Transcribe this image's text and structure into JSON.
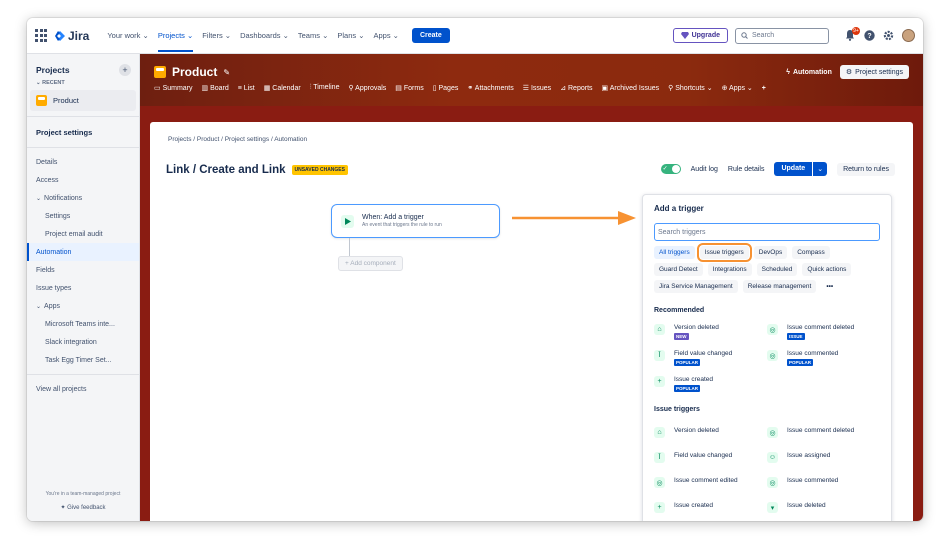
{
  "topnav": {
    "logo": "Jira",
    "items": [
      "Your work ⌄",
      "Projects ⌄",
      "Filters ⌄",
      "Dashboards ⌄",
      "Teams ⌄",
      "Plans ⌄",
      "Apps ⌄"
    ],
    "create": "Create",
    "upgrade": "Upgrade",
    "search_placeholder": "Search",
    "notif_count": "9+"
  },
  "sidebar": {
    "title": "Projects",
    "recent": "RECENT",
    "project": "Product",
    "settings": "Project settings",
    "items": [
      "Details",
      "Access",
      "Notifications",
      "Settings",
      "Project email audit",
      "Automation",
      "Fields",
      "Issue types",
      "Apps",
      "Microsoft Teams inte...",
      "Slack integration",
      "Task Egg Timer Set..."
    ],
    "view_all": "View all projects",
    "footer": "You're in a team-managed project",
    "feedback": "Give feedback"
  },
  "project": {
    "title": "Product",
    "automation": "Automation",
    "settings_btn": "Project settings",
    "tabs": [
      "Summary",
      "Board",
      "List",
      "Calendar",
      "Timeline",
      "Approvals",
      "Forms",
      "Pages",
      "Attachments",
      "Issues",
      "Reports",
      "Archived Issues",
      "Shortcuts ⌄",
      "Apps ⌄",
      "+"
    ]
  },
  "rule": {
    "breadcrumb": "Projects  /  Product  /  Project settings  /  Automation",
    "title": "Link / Create and Link",
    "unsaved": "UNSAVED CHANGES",
    "audit": "Audit log",
    "details": "Rule details",
    "update": "Update",
    "return": "Return to rules"
  },
  "trigger_node": {
    "title": "When: Add a trigger",
    "subtitle": "An event that triggers the rule to run",
    "add_component": "Add component"
  },
  "panel": {
    "title": "Add a trigger",
    "search_placeholder": "Search triggers",
    "chips": [
      "All triggers",
      "Issue triggers",
      "DevOps",
      "Compass",
      "Guard Detect",
      "Integrations",
      "Scheduled",
      "Quick actions",
      "Jira Service Management",
      "Release management",
      "•••"
    ],
    "recommended_title": "Recommended",
    "recommended": [
      {
        "label": "Version deleted",
        "badge": "NEW"
      },
      {
        "label": "Issue comment deleted",
        "badge": "ISSUE"
      },
      {
        "label": "Field value changed",
        "badge": "POPULAR"
      },
      {
        "label": "Issue commented",
        "badge": "POPULAR"
      },
      {
        "label": "Issue created",
        "badge": "POPULAR"
      }
    ],
    "issue_title": "Issue triggers",
    "issue_triggers": [
      "Version deleted",
      "Issue comment deleted",
      "Field value changed",
      "Issue assigned",
      "Issue comment edited",
      "Issue commented",
      "Issue created",
      "Issue deleted"
    ]
  },
  "colors": {
    "accent": "#0052cc",
    "header_bg": "#8e2a0f",
    "highlight": "#f79232"
  }
}
